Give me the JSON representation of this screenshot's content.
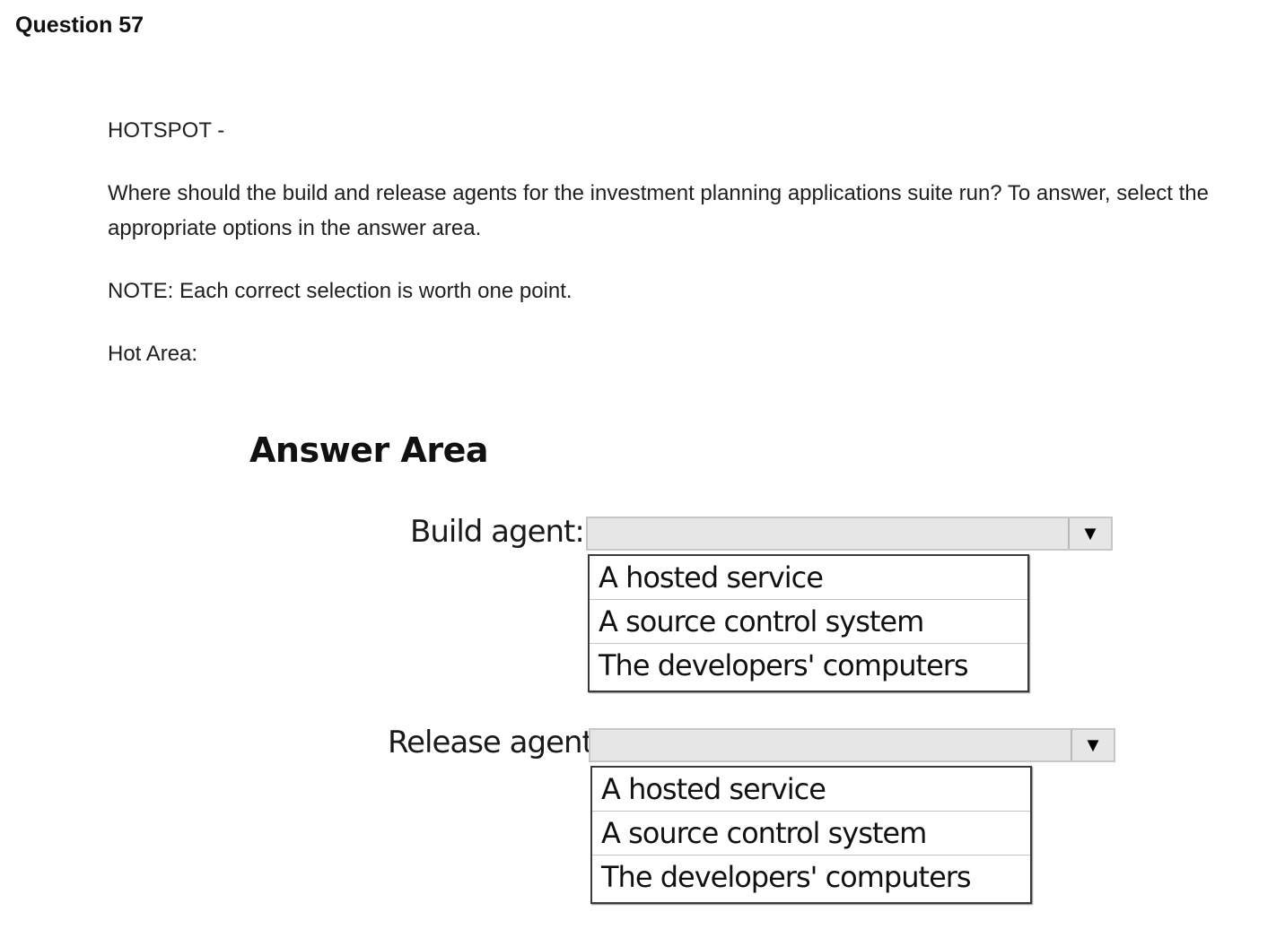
{
  "question": {
    "title": "Question 57",
    "type_label": "HOTSPOT -",
    "prompt": "Where should the build and release agents for the investment planning applications suite run? To answer, select the appropriate options in the answer area.",
    "note": "NOTE: Each correct selection is worth one point.",
    "hot_area_label": "Hot Area:"
  },
  "answer_area": {
    "title": "Answer Area",
    "build_agent": {
      "label": "Build agent:",
      "selected_value": "",
      "dropdown_icon": "triangle-down-icon",
      "dropdown_glyph": "▼",
      "options": [
        "A hosted service",
        "A source control system",
        "The developers' computers"
      ]
    },
    "release_agent": {
      "label": "Release agent:",
      "selected_value": "",
      "dropdown_icon": "triangle-down-icon",
      "dropdown_glyph": "▼",
      "options": [
        "A hosted service",
        "A source control system",
        "The developers' computers"
      ]
    }
  }
}
